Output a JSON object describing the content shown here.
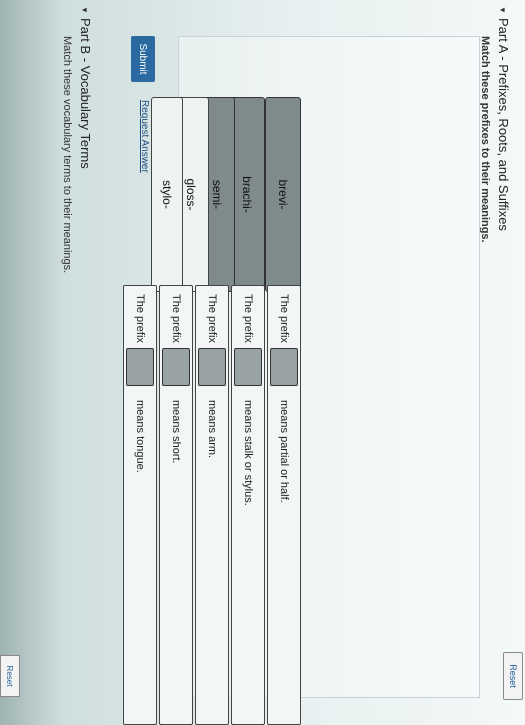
{
  "partA": {
    "title": "Part A - Prefixes, Roots, and Suffixes",
    "instructions": "Match these prefixes to their meanings.",
    "reset_label": "Reset",
    "chips": [
      "brevi-",
      "brachi-",
      "semi-",
      "gloss-",
      "stylo-"
    ],
    "rows": [
      {
        "prefix_label": "The prefix",
        "meaning": "means partial or half."
      },
      {
        "prefix_label": "The prefix",
        "meaning": "means stalk or stylus."
      },
      {
        "prefix_label": "The prefix",
        "meaning": "means arm."
      },
      {
        "prefix_label": "The prefix",
        "meaning": "means short."
      },
      {
        "prefix_label": "The prefix",
        "meaning": "means tongue."
      }
    ],
    "submit_label": "Submit",
    "request_answer_label": "Request Answer"
  },
  "partB": {
    "title": "Part B - Vocabulary Terms",
    "instructions": "Match these vocabulary terms to their meanings.",
    "corner_label": "Reset"
  }
}
